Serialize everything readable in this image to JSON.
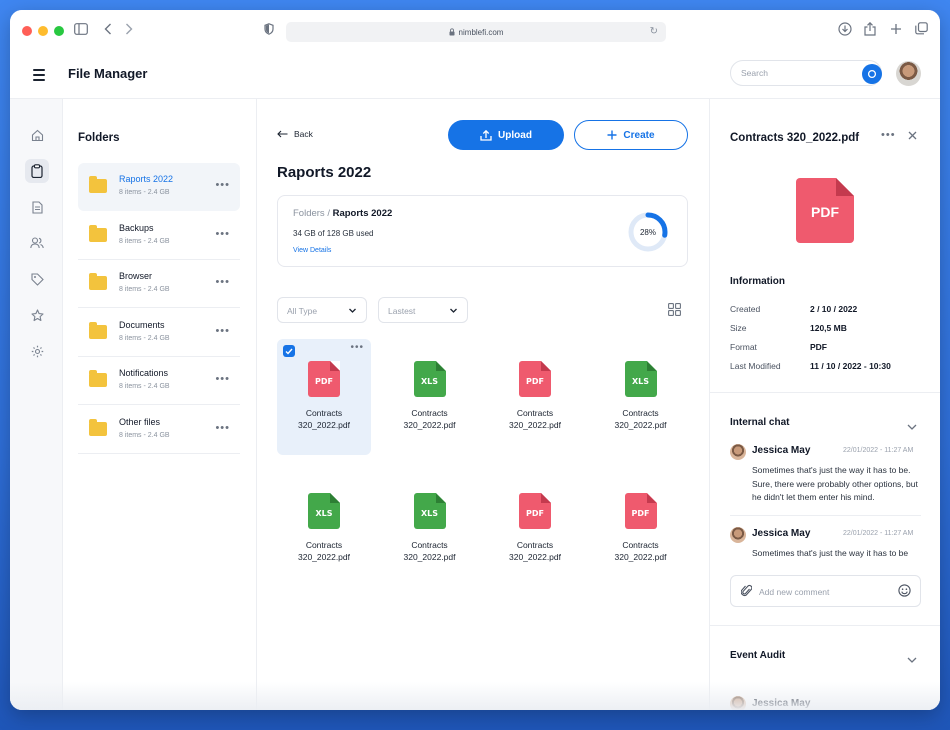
{
  "browser": {
    "url": "nimblefi.com",
    "traffic_colors": [
      "#ff5f57",
      "#febc2e",
      "#28c840"
    ]
  },
  "header": {
    "title": "File Manager",
    "search_placeholder": "Search"
  },
  "rail": {
    "items": [
      "home-icon",
      "clipboard-icon",
      "document-icon",
      "users-icon",
      "tag-icon",
      "star-icon",
      "settings-icon"
    ],
    "active_index": 1
  },
  "folders": {
    "title": "Folders",
    "items": [
      {
        "name": "Raports 2022",
        "meta": "8 items - 2.4 GB",
        "active": true
      },
      {
        "name": "Backups",
        "meta": "8 items - 2.4 GB"
      },
      {
        "name": "Browser",
        "meta": "8 items - 2.4 GB"
      },
      {
        "name": "Documents",
        "meta": "8 items - 2.4 GB"
      },
      {
        "name": "Notifications",
        "meta": "8 items - 2.4 GB"
      },
      {
        "name": "Other files",
        "meta": "8 items - 2.4 GB"
      }
    ]
  },
  "main": {
    "back_label": "Back",
    "upload_label": "Upload",
    "create_label": "Create",
    "title": "Raports 2022",
    "usage": {
      "crumb_parent": "Folders /",
      "crumb_current": "Raports 2022",
      "used_text": "34 GB of 128 GB used",
      "view_details": "View Details",
      "percent_label": "28%",
      "percent_value": 0.28
    },
    "filters": {
      "type": "All Type",
      "sort": "Lastest"
    },
    "files": [
      {
        "type": "PDF",
        "line1": "Contracts",
        "line2": "320_2022.pdf",
        "selected": true
      },
      {
        "type": "XLS",
        "line1": "Contracts",
        "line2": "320_2022.pdf"
      },
      {
        "type": "PDF",
        "line1": "Contracts",
        "line2": "320_2022.pdf"
      },
      {
        "type": "XLS",
        "line1": "Contracts",
        "line2": "320_2022.pdf"
      },
      {
        "type": "XLS",
        "line1": "Contracts",
        "line2": "320_2022.pdf"
      },
      {
        "type": "XLS",
        "line1": "Contracts",
        "line2": "320_2022.pdf"
      },
      {
        "type": "PDF",
        "line1": "Contracts",
        "line2": "320_2022.pdf"
      },
      {
        "type": "PDF",
        "line1": "Contracts",
        "line2": "320_2022.pdf"
      }
    ]
  },
  "details": {
    "title": "Contracts 320_2022.pdf",
    "preview_type": "PDF",
    "information_title": "Information",
    "info": [
      {
        "label": "Created",
        "value": "2 / 10 / 2022"
      },
      {
        "label": "Size",
        "value": "120,5 MB"
      },
      {
        "label": "Format",
        "value": "PDF"
      },
      {
        "label": "Last Modified",
        "value": "11 / 10 / 2022 - 10:30"
      }
    ],
    "chat_title": "Internal chat",
    "comments": [
      {
        "name": "Jessica May",
        "time": "22/01/2022 - 11:27 AM",
        "text": "Sometimes that's just the way it has to be. Sure, there were probably other options, but he didn't let them enter his mind."
      },
      {
        "name": "Jessica May",
        "time": "22/01/2022 - 11:27 AM",
        "text": "Sometimes that's just the way it has to be"
      }
    ],
    "comment_placeholder": "Add new comment",
    "audit_title": "Event Audit",
    "audit_user": "Jessica May"
  },
  "colors": {
    "accent": "#1673e6",
    "pdf": "#ef5a6e",
    "xls": "#43a84a",
    "folder": "#f3c33d"
  }
}
